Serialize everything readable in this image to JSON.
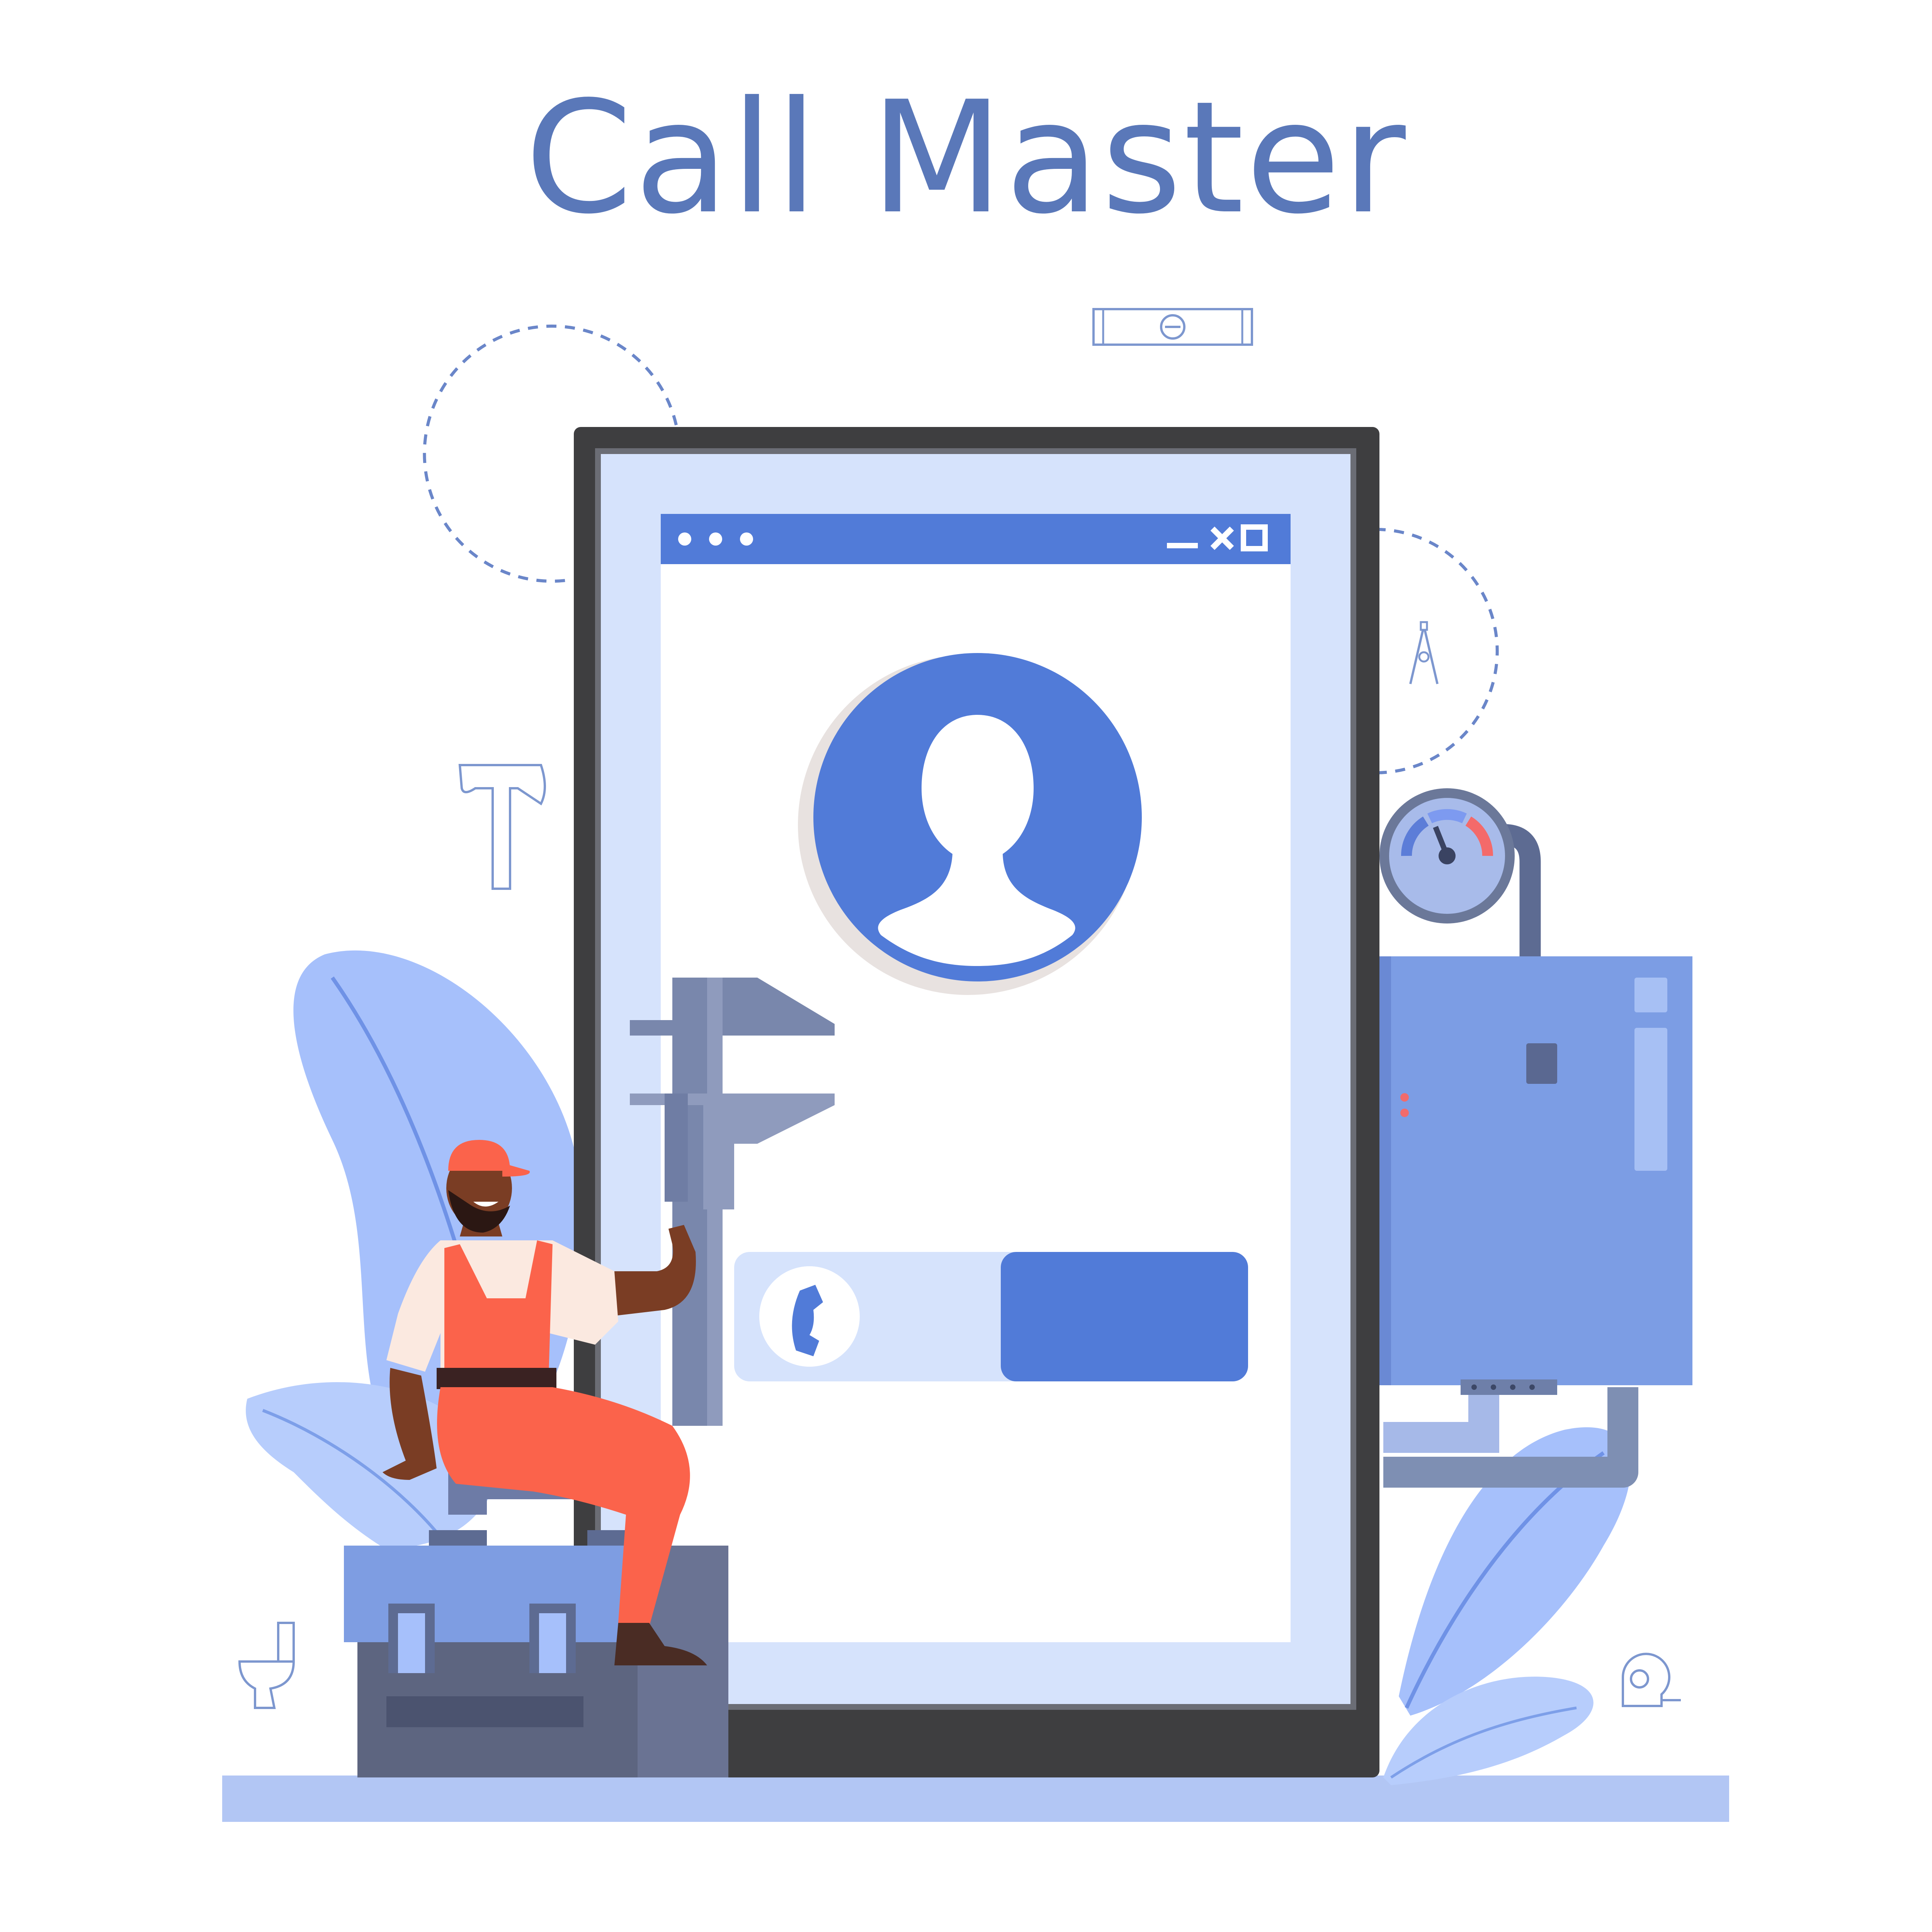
{
  "page": {
    "title": "Call Master"
  },
  "app_window": {
    "controls": [
      "minimize-icon",
      "close-icon",
      "maximize-icon"
    ],
    "menu_dots": [
      "dot-icon",
      "dot-icon",
      "dot-icon"
    ]
  },
  "call_button": {
    "icon": "phone-icon",
    "label": ""
  },
  "colors": {
    "title": "#5a78b9",
    "accent_blue": "#517bd8",
    "light_blue_panel": "#d6e3fc",
    "device_frame": "#3e3e40",
    "leaf_blue": "#a6c0fb",
    "worker_orange": "#fb634b",
    "ground": "#b2c6f4",
    "boiler_blue": "#7c9de4"
  },
  "icons": [
    "spirit-level-icon",
    "hammer-icon",
    "compass-icon",
    "toilet-icon",
    "tape-measure-icon",
    "pressure-gauge-icon",
    "caliper-icon",
    "toolbox-icon",
    "user-avatar-icon"
  ]
}
